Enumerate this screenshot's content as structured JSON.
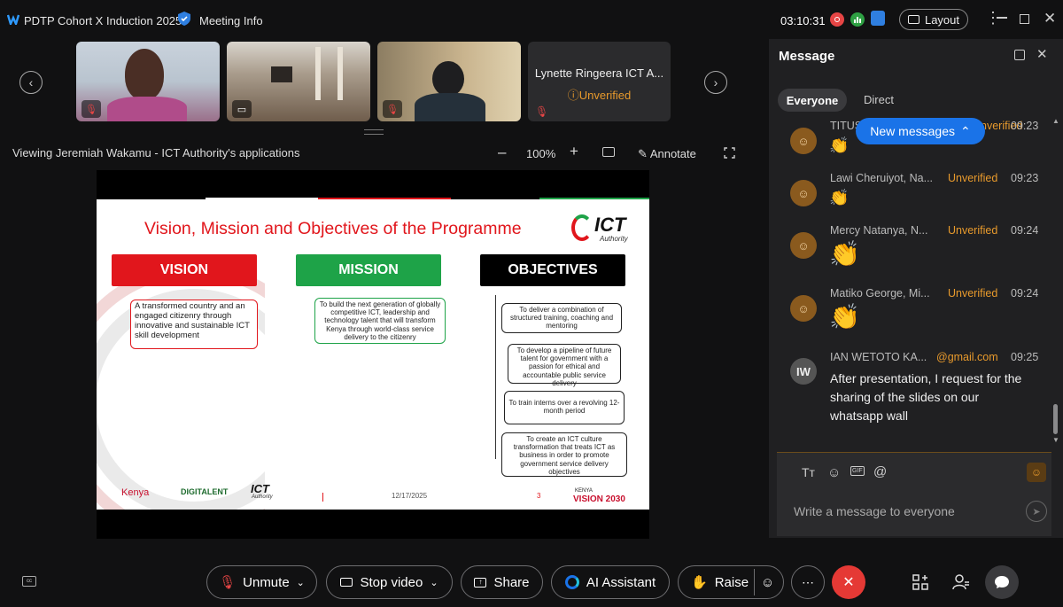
{
  "window": {
    "title": "PDTP Cohort X Induction 2025",
    "meeting_info": "Meeting Info",
    "timer": "03:10:31",
    "layout": "Layout"
  },
  "thumbs": {
    "named_participant": "Lynette Ringeera ICT A...",
    "unverified": "Unverified"
  },
  "share": {
    "viewing": "Viewing Jeremiah Wakamu - ICT Authority's applications",
    "zoom": "100%",
    "annotate": "Annotate",
    "minus": "–",
    "plus": "+"
  },
  "slide": {
    "title": "Vision, Mission and Objectives of the Programme",
    "logo_top": "ICT",
    "logo_sub": "Authority",
    "vision_hdr": "VISION",
    "mission_hdr": "MISSION",
    "objectives_hdr": "OBJECTIVES",
    "vision_text": "A transformed country and an engaged citizenry through innovative and sustainable ICT skill development",
    "mission_text": "To build the next generation of globally competitive ICT, leadership and technology talent that will transform Kenya through world-class service delivery to the citizenry",
    "objectives": [
      "To deliver a combination of structured training, coaching and mentoring",
      "To develop a pipeline of future talent for government with a passion for ethical and accountable public service delivery",
      "To train interns over a revolving 12-month period",
      "To create an ICT culture transformation that treats ICT as business in order to promote government service delivery objectives"
    ],
    "footer_kenya": "Kenya",
    "footer_digi": "DIGITALENT",
    "footer_ict": "ICT",
    "footer_auth": "Authority",
    "date": "12/17/2025",
    "page": "3",
    "kenya_small": "KENYA",
    "vision2030": "VISION 2030"
  },
  "messages": {
    "title": "Message",
    "tabs": [
      "Everyone",
      "Direct"
    ],
    "new_messages": "New messages",
    "list": [
      {
        "name": "TITUS",
        "status": "Unverified",
        "time": "09:23",
        "emoji": "👏"
      },
      {
        "name": "Lawi Cheruiyot, Na...",
        "status": "Unverified",
        "time": "09:23",
        "emoji": "👏"
      },
      {
        "name": "Mercy Natanya, N...",
        "status": "Unverified",
        "time": "09:24",
        "emoji": "👏"
      },
      {
        "name": "Matiko George, Mi...",
        "status": "Unverified",
        "time": "09:24",
        "emoji": "👏"
      },
      {
        "name": "IAN WETOTO KA...",
        "status": "@gmail.com",
        "time": "09:25",
        "initials": "IW",
        "text": "After presentation, I request  for the sharing of the slides on our whatsapp wall"
      }
    ],
    "input_placeholder": "Write a message to everyone",
    "gif": "GIF"
  },
  "controls": {
    "unmute": "Unmute",
    "stop_video": "Stop video",
    "share": "Share",
    "ai": "AI Assistant",
    "raise": "Raise"
  },
  "colors": {
    "accent": "#1a6fe0",
    "unverified": "#e89a2c",
    "end": "#e53935",
    "vision": "#e1161c",
    "mission": "#1ea348",
    "objectives": "#000000"
  }
}
